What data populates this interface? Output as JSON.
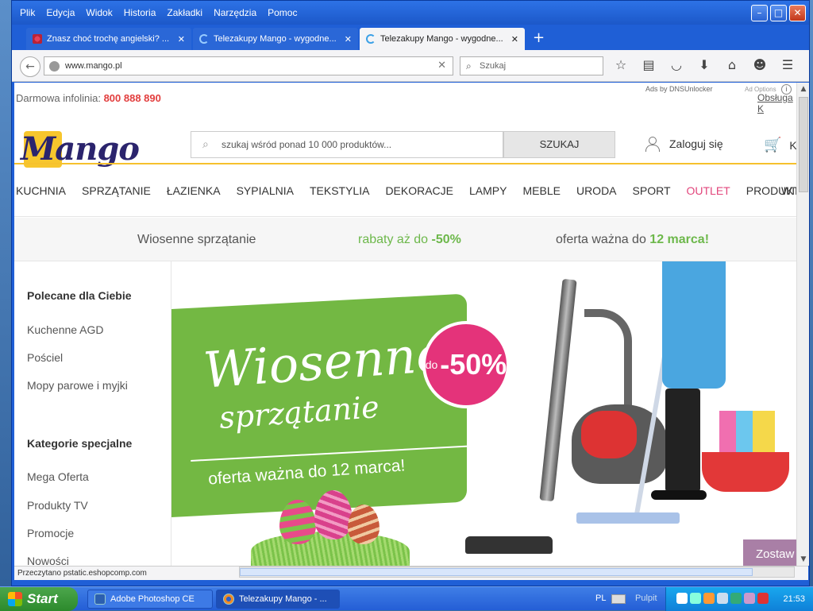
{
  "menubar": {
    "items": [
      "Plik",
      "Edycja",
      "Widok",
      "Historia",
      "Zakładki",
      "Narzędzia",
      "Pomoc"
    ]
  },
  "tabs": [
    {
      "title": "Znasz choć trochę angielski? ..."
    },
    {
      "title": "Telezakupy Mango - wygodne..."
    },
    {
      "title": "Telezakupy Mango - wygodne..."
    }
  ],
  "navbar": {
    "url": "www.mango.pl",
    "search_placeholder": "Szukaj"
  },
  "status": {
    "text": "Przeczytano pstatic.eshopcomp.com"
  },
  "page": {
    "ads": "Ads by DNSUnlocker",
    "ad_options": "Ad Options",
    "hotline_label": "Darmowa infolinia:",
    "hotline_number": "800 888 890",
    "login_top": "Obsługa K",
    "logo": "Mango",
    "search_placeholder": "szukaj wśród ponad 10 000 produktów...",
    "search_button": "SZUKAJ",
    "login": "Zaloguj się",
    "cart": "Ko",
    "categories": [
      "KUCHNIA",
      "SPRZĄTANIE",
      "ŁAZIENKA",
      "SYPIALNIA",
      "TEKSTYLIA",
      "DEKORACJE",
      "LAMPY",
      "MEBLE",
      "URODA",
      "SPORT",
      "OUTLET",
      "PRODUKTY TV"
    ],
    "categories_extra": "WIE",
    "promo": {
      "left": "Wiosenne sprzątanie",
      "mid_prefix": "rabaty aż do ",
      "mid_value": "-50%",
      "right_prefix": "oferta ważna do ",
      "right_value": "12 marca!"
    },
    "sidebar": {
      "heading1": "Polecane dla Ciebie",
      "links1": [
        "Kuchenne AGD",
        "Pościel",
        "Mopy parowe i myjki"
      ],
      "heading2": "Kategorie specjalne",
      "links2": [
        "Mega Oferta",
        "Produkty TV",
        "Promocje",
        "Nowości"
      ]
    },
    "banner": {
      "line1": "Wiosenne",
      "line2": "sprzątanie",
      "offer": "oferta ważna do 12 marca!",
      "badge_do": "do",
      "badge_pct": "-50%"
    },
    "chat": "Zostaw wiadomość"
  },
  "taskbar": {
    "start": "Start",
    "tasks": [
      "Adobe Photoshop CE",
      "Telezakupy Mango - ..."
    ],
    "lang": "PL",
    "desktop": "Pulpit",
    "clock": "21:53"
  },
  "colors": {
    "accent_yellow": "#f6c12d",
    "outlet_pink": "#e2467c",
    "green": "#73b843",
    "badge_pink": "#e4337a"
  }
}
